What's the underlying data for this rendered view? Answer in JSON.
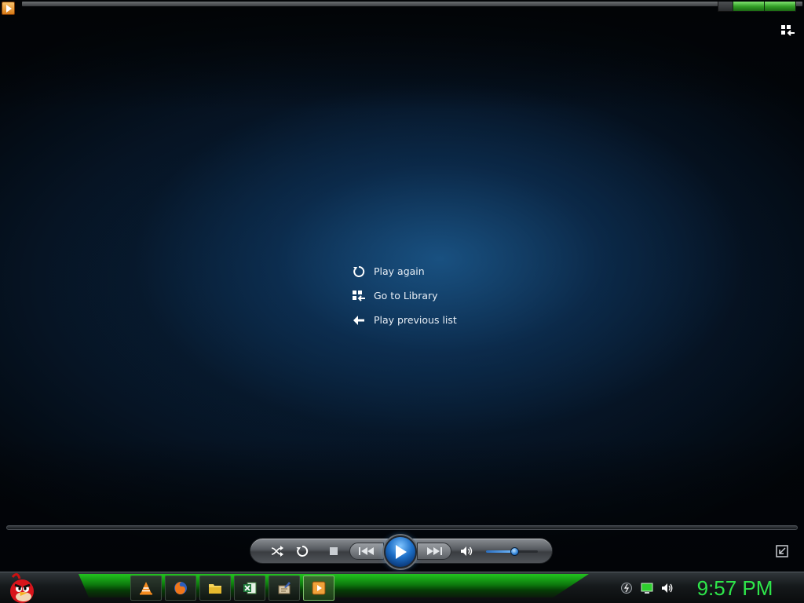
{
  "window": {
    "app_icon": "media-player-icon",
    "switch_icon": "switch-to-library-icon"
  },
  "end_menu": {
    "items": [
      {
        "label": "Play again",
        "icon": "replay-icon"
      },
      {
        "label": "Go to Library",
        "icon": "library-grid-icon"
      },
      {
        "label": "Play previous list",
        "icon": "back-arrow-icon"
      }
    ]
  },
  "controls": {
    "shuffle_icon": "shuffle-icon",
    "repeat_icon": "repeat-icon",
    "stop_icon": "stop-icon",
    "previous_icon": "previous-icon",
    "play_icon": "play-icon",
    "next_icon": "next-icon",
    "mute_icon": "speaker-icon",
    "volume_level": 0.55,
    "seek_position": 0,
    "mini_mode_icon": "switch-to-skin-icon"
  },
  "taskbar": {
    "start_icon": "angry-bird-start-icon",
    "apps": [
      {
        "name": "vlc-icon"
      },
      {
        "name": "firefox-icon"
      },
      {
        "name": "folder-icon"
      },
      {
        "name": "excel-icon"
      },
      {
        "name": "writing-app-icon"
      },
      {
        "name": "media-player-icon",
        "active": true
      }
    ],
    "tray": [
      "network-icon",
      "monitor-icon",
      "volume-icon"
    ],
    "clock": "9:57 PM"
  },
  "colors": {
    "accent_green": "#2ee64a",
    "play_blue": "#1d6fc7"
  }
}
